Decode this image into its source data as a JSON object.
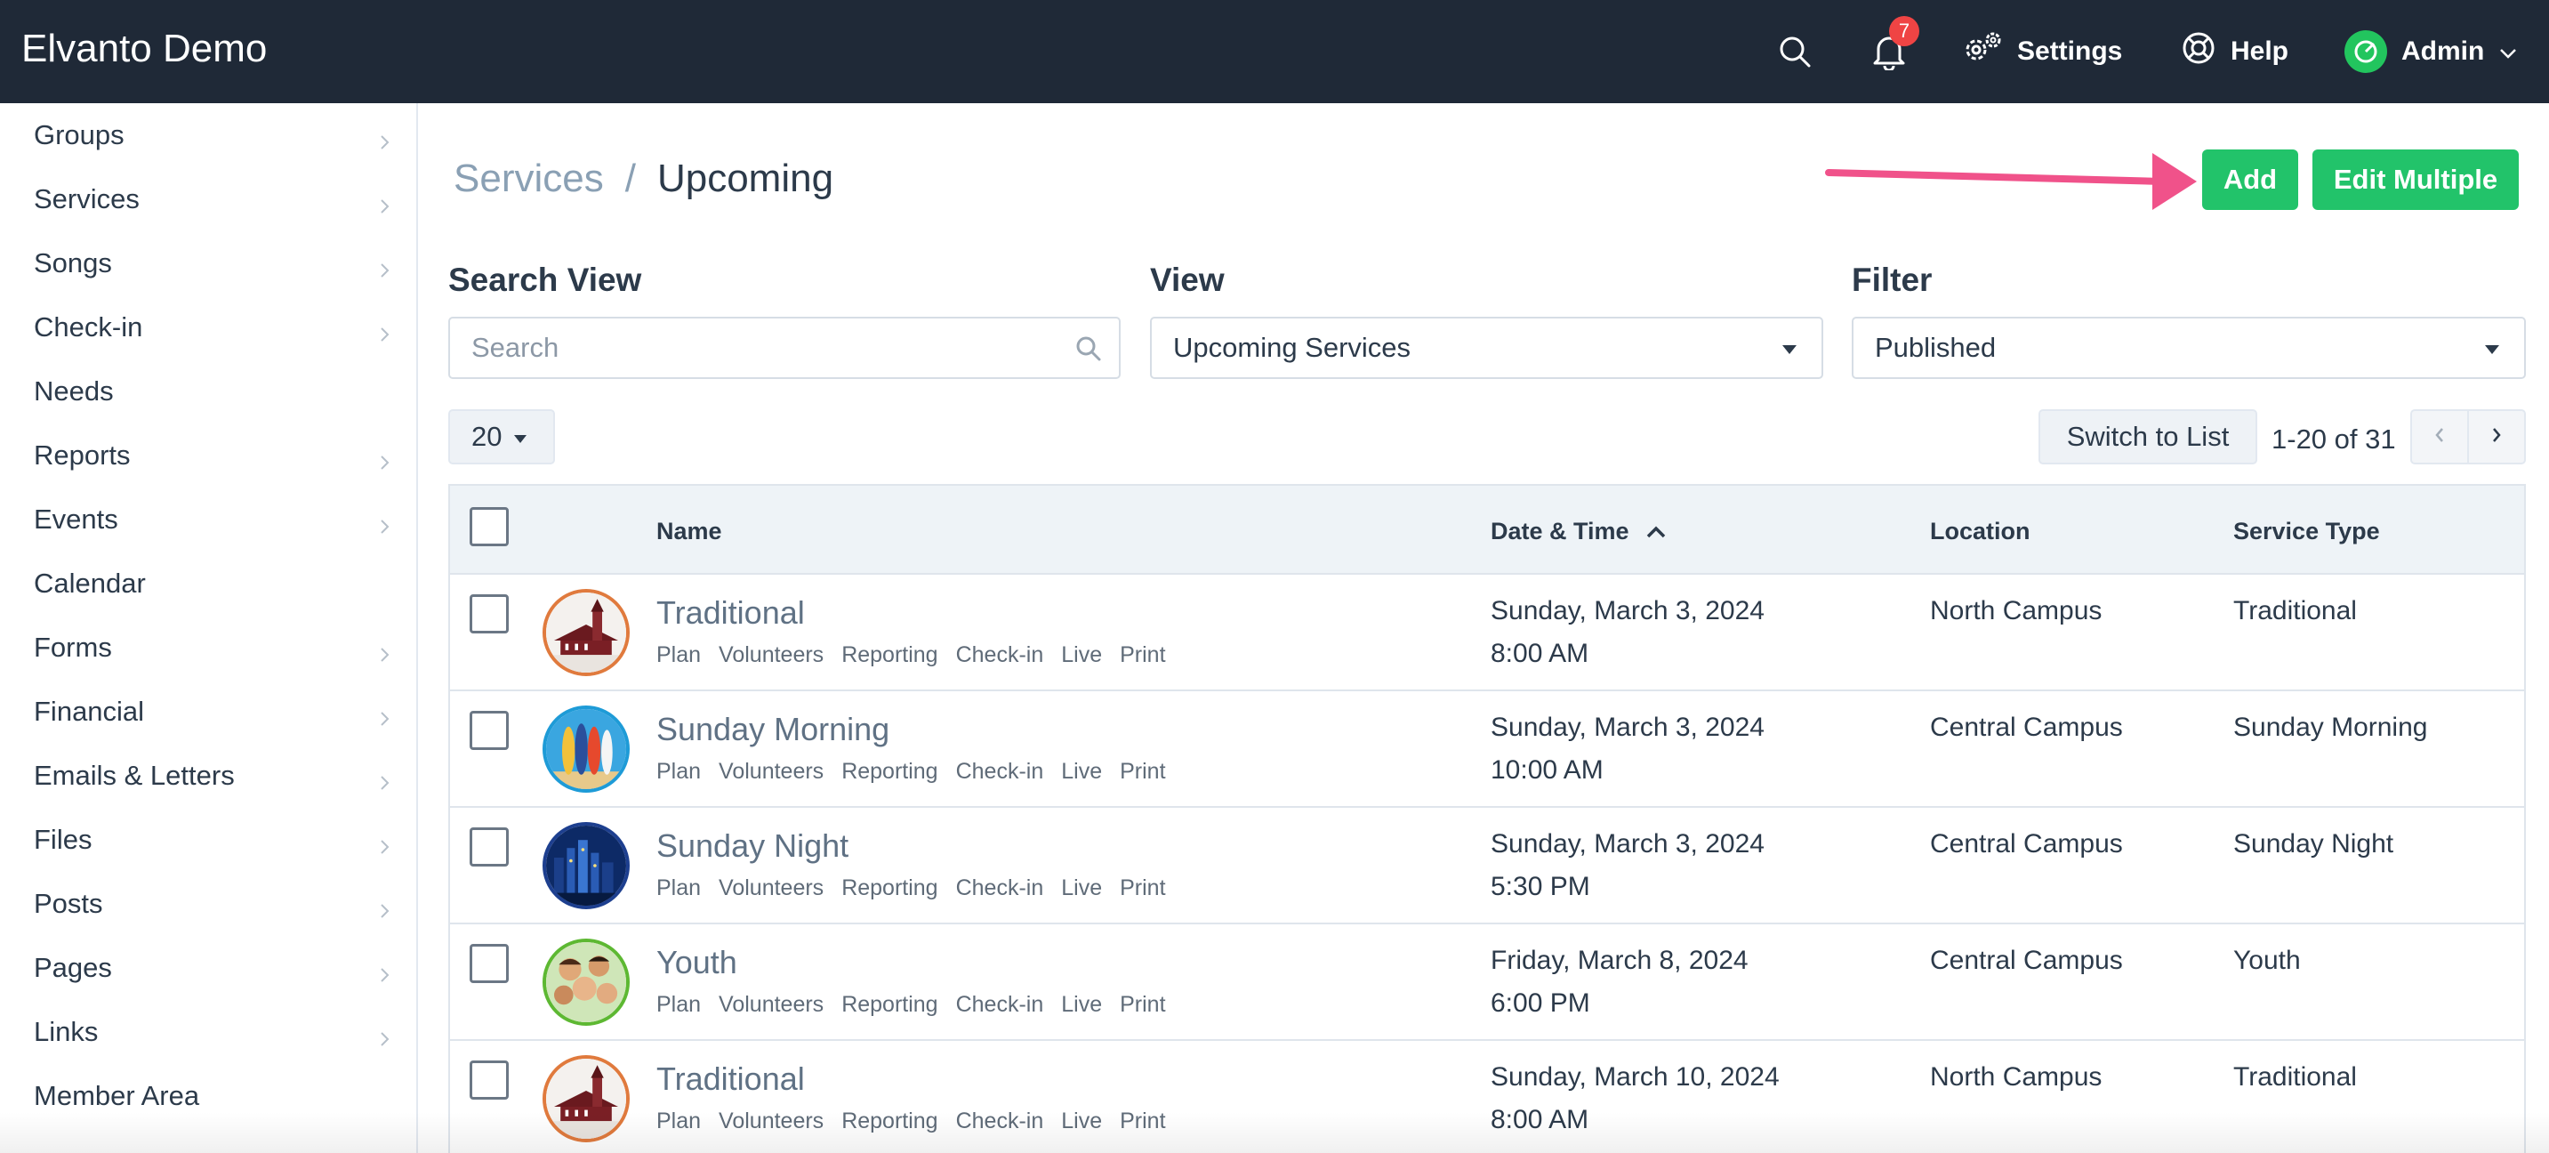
{
  "app": {
    "title": "Elvanto Demo"
  },
  "topbar": {
    "notification_count": "7",
    "settings_label": "Settings",
    "help_label": "Help",
    "user_label": "Admin",
    "icons": [
      "search-icon",
      "bell-icon",
      "gear-icon",
      "lifebuoy-icon",
      "chevron-down-icon"
    ]
  },
  "sidebar": {
    "items": [
      {
        "label": "Groups",
        "has_children": true
      },
      {
        "label": "Services",
        "has_children": true
      },
      {
        "label": "Songs",
        "has_children": true
      },
      {
        "label": "Check-in",
        "has_children": true
      },
      {
        "label": "Needs",
        "has_children": false
      },
      {
        "label": "Reports",
        "has_children": true
      },
      {
        "label": "Events",
        "has_children": true
      },
      {
        "label": "Calendar",
        "has_children": false
      },
      {
        "label": "Forms",
        "has_children": true
      },
      {
        "label": "Financial",
        "has_children": true
      },
      {
        "label": "Emails & Letters",
        "has_children": true
      },
      {
        "label": "Files",
        "has_children": true
      },
      {
        "label": "Posts",
        "has_children": true
      },
      {
        "label": "Pages",
        "has_children": true
      },
      {
        "label": "Links",
        "has_children": true
      },
      {
        "label": "Member Area",
        "has_children": false
      }
    ]
  },
  "breadcrumb": {
    "root": "Services",
    "separator": "/",
    "current": "Upcoming"
  },
  "actions": {
    "add_label": "Add",
    "edit_multiple_label": "Edit Multiple"
  },
  "filters": {
    "search_label": "Search View",
    "search_placeholder": "Search",
    "view_label": "View",
    "view_value": "Upcoming Services",
    "filter_label": "Filter",
    "filter_value": "Published"
  },
  "pager": {
    "page_size": "20",
    "switch_label": "Switch to List",
    "range": "1-20 of 31"
  },
  "table": {
    "columns": [
      "Name",
      "Date & Time",
      "Location",
      "Service Type"
    ],
    "sort_column": "Date & Time",
    "sort_direction": "ascending",
    "row_links": [
      "Plan",
      "Volunteers",
      "Reporting",
      "Check-in",
      "Live",
      "Print"
    ],
    "rows": [
      {
        "name": "Traditional",
        "date": "Sunday, March 3, 2024",
        "time": "8:00 AM",
        "location": "North Campus",
        "type": "Traditional",
        "thumb": "church",
        "ring": "#e07a3d"
      },
      {
        "name": "Sunday Morning",
        "date": "Sunday, March 3, 2024",
        "time": "10:00 AM",
        "location": "Central Campus",
        "type": "Sunday Morning",
        "thumb": "surfboards",
        "ring": "#1e9bd7"
      },
      {
        "name": "Sunday Night",
        "date": "Sunday, March 3, 2024",
        "time": "5:30 PM",
        "location": "Central Campus",
        "type": "Sunday Night",
        "thumb": "city-night",
        "ring": "#1d3f8f"
      },
      {
        "name": "Youth",
        "date": "Friday, March 8, 2024",
        "time": "6:00 PM",
        "location": "Central Campus",
        "type": "Youth",
        "thumb": "youth-group",
        "ring": "#5db832"
      },
      {
        "name": "Traditional",
        "date": "Sunday, March 10, 2024",
        "time": "8:00 AM",
        "location": "North Campus",
        "type": "Traditional",
        "thumb": "church",
        "ring": "#e07a3d"
      }
    ]
  },
  "colors": {
    "topbar": "#1f2937",
    "accent_green": "#22c36a",
    "annotation_arrow": "#f0528a",
    "badge": "#ef4444"
  }
}
